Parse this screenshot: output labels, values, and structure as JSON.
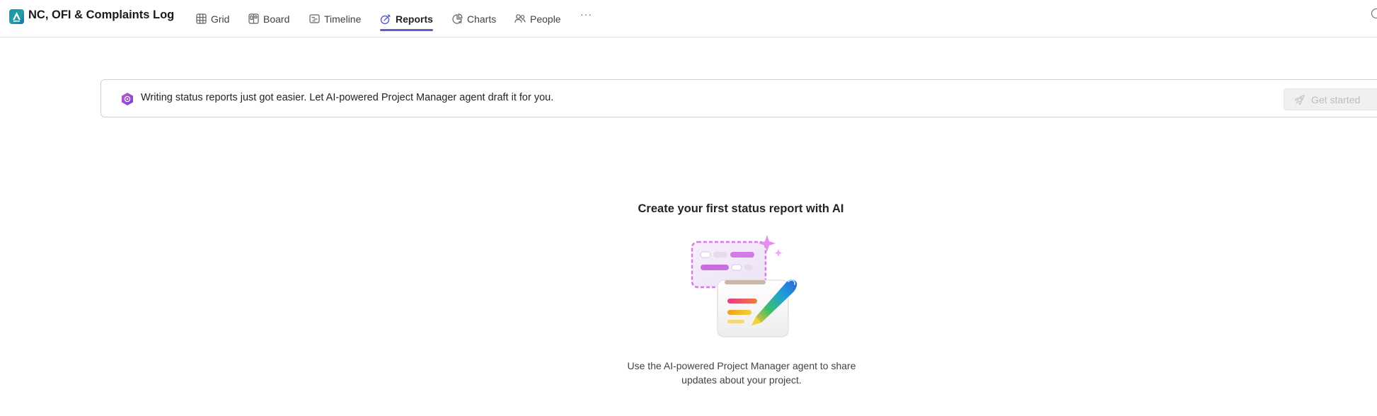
{
  "header": {
    "title": "NC, OFI & Complaints Log",
    "logo_icon": "planner-app-icon",
    "tabs": [
      {
        "label": "Grid",
        "icon": "grid-icon",
        "active": false
      },
      {
        "label": "Board",
        "icon": "board-icon",
        "active": false
      },
      {
        "label": "Timeline",
        "icon": "timeline-icon",
        "active": false
      },
      {
        "label": "Reports",
        "icon": "reports-icon",
        "active": true
      },
      {
        "label": "Charts",
        "icon": "charts-icon",
        "active": false
      },
      {
        "label": "People",
        "icon": "people-icon",
        "active": false
      }
    ],
    "more_label": "···"
  },
  "banner": {
    "icon": "copilot-agent-icon",
    "text": "Writing status reports just got easier. Let AI-powered Project Manager agent draft it for you.",
    "button_label": "Get started",
    "button_icon": "rocket-icon",
    "button_disabled": true
  },
  "empty_state": {
    "title": "Create your first status report with AI",
    "illustration": "status-report-pen-illustration",
    "description": "Use the AI-powered Project Manager agent to share updates about your project."
  },
  "colors": {
    "accent": "#5b5fc7",
    "border": "#d1d1d1",
    "disabled_text": "#bdbdbd"
  }
}
